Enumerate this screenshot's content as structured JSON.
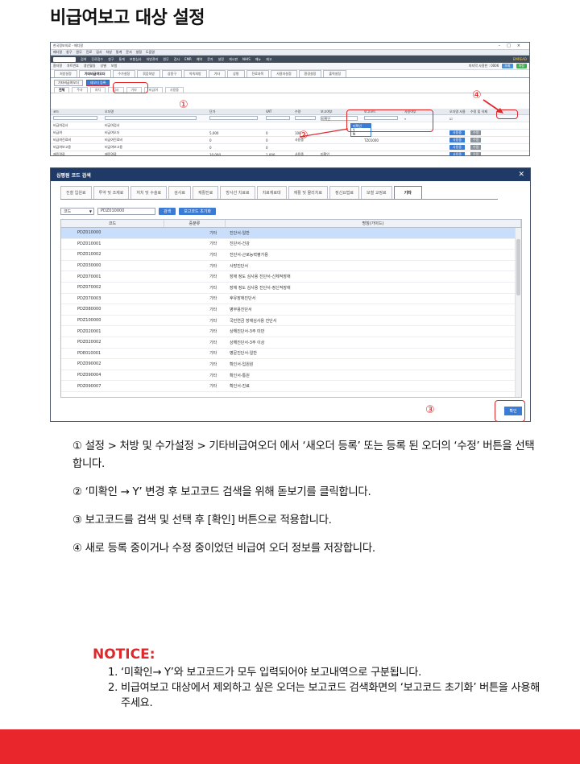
{
  "page_title": "비급여보고 대상 설정",
  "screen1": {
    "window_title": "한국정보의료 - 메디칼",
    "menu_items": [
      "메디칼",
      "청구",
      "원무",
      "진료",
      "검사",
      "처방",
      "통계",
      "문서",
      "설정",
      "도움말"
    ],
    "nav_items": [
      "검색",
      "진료접수",
      "청구",
      "통계",
      "보험심사",
      "처방관리",
      "원무",
      "검사",
      "EMR",
      "예약",
      "문자",
      "설정",
      "게시판",
      "NHIS",
      "메뉴",
      "재고"
    ],
    "nav_brand": "EMREAD",
    "patient_bar": [
      "환자명",
      "차트번호",
      "생년월일",
      "성별",
      "보험"
    ],
    "patient_right": "마지막 사용한 : 0006",
    "patient_btn_a": "조회",
    "patient_btn_b": "저장",
    "tabs": [
      "처방설정",
      "기타비급여오더",
      "수가설정",
      "묶음처방",
      "상용구",
      "약속처방",
      "기타",
      "상병",
      "진료과목",
      "사용자설정",
      "환경설정",
      "출력설정"
    ],
    "active_tab": "기타비급여오더",
    "buttons": [
      "기타비급여오더",
      "새오더 등록"
    ],
    "subtabs": [
      "전체",
      "주사",
      "처치",
      "검사",
      "기타",
      "비급여",
      "사용중"
    ],
    "table_headers": [
      "코드",
      "오더명",
      "단가",
      "VAT",
      "수량",
      "보고여부",
      "보고코드",
      "사용여부",
      "오더명 사용",
      "수정 및 삭제"
    ],
    "rows": [
      [
        "비급여검사",
        "비급여검사",
        "",
        "",
        "",
        "",
        "",
        "",
        "",
        ""
      ],
      [
        "비급여",
        "비급여오더",
        "5,000",
        "0",
        "100",
        "",
        "",
        "",
        "사용중",
        "수정"
      ],
      [
        "비급여진료비",
        "비급여진료비",
        "0",
        "0",
        "사용중",
        "",
        "TZ01000",
        "",
        "사용중",
        "수정"
      ],
      [
        "비급여보고용",
        "비급여보고용",
        "0",
        "0",
        "",
        "",
        "",
        "",
        "사용중",
        "수정"
      ],
      [
        "제증명료",
        "제증명료",
        "10,000",
        "1,000",
        "사용중",
        "미확인",
        "",
        "",
        "사용중",
        "수정"
      ]
    ],
    "dropdown_options": [
      "미확인",
      "Y",
      "N"
    ],
    "filter_value": "미확인",
    "markers": [
      "①",
      "②",
      "④"
    ]
  },
  "screen2": {
    "dialog_title": "심평원 코드 검색",
    "tabs": [
      "진찰 입원료",
      "투약 및 조제료",
      "처치 및 수술료",
      "검사료",
      "재활진료",
      "방사선 치료료",
      "치료재료대",
      "재활 및 물리치료",
      "정신요법료",
      "보철 교정료",
      "기타"
    ],
    "active_tab": "기타",
    "search_select": "코드",
    "search_value": "PDZ010000",
    "search_button": "검색",
    "reset_button": "보고코드 초기화",
    "columns": [
      "코드",
      "중분류",
      "명칭(가이드)"
    ],
    "rows": [
      [
        "PDZ010000",
        "기타",
        "진단서-일반"
      ],
      [
        "PDZ010001",
        "기타",
        "진단서-건강"
      ],
      [
        "PDZ010002",
        "기타",
        "진단서-근로능력평가용"
      ],
      [
        "PDZ030000",
        "기타",
        "사망진단서"
      ],
      [
        "PDZ070001",
        "기타",
        "장애 정도 심사용 진단서-신체적장애"
      ],
      [
        "PDZ070002",
        "기타",
        "장애 정도 심사용 진단서-정신적장애"
      ],
      [
        "PDZ070003",
        "기타",
        "후유장애진단서"
      ],
      [
        "PDZ080000",
        "기타",
        "병무용진단서"
      ],
      [
        "PDZ100000",
        "기타",
        "국민연금 장애심사용 진단서"
      ],
      [
        "PDZ020001",
        "기타",
        "상해진단서-3주 미만"
      ],
      [
        "PDZ020002",
        "기타",
        "상해진단서-3주 이상"
      ],
      [
        "PDE010001",
        "기타",
        "병문진단서-일반"
      ],
      [
        "PDZ090002",
        "기타",
        "확인서-입원원"
      ],
      [
        "PDZ090004",
        "기타",
        "확인서-통원"
      ],
      [
        "PDZ090007",
        "기타",
        "확인서-진료"
      ]
    ],
    "ok_button": "확인",
    "marker": "③"
  },
  "steps": [
    "① 설정 > 처방 및 수가설정 > 기타비급여오더 에서 ‘새오더 등록’ 또는 등록 된 오더의 ‘수정’ 버튼을 선택합니다.",
    "② ‘미확인 → Y’ 변경 후  보고코드 검색을 위해 돋보기를 클릭합니다.",
    "③ 보고코드를 검색 및 선택 후 [확인] 버튼으로 적용합니다.",
    "④ 새로 등록 중이거나 수정 중이었던 비급여 오더 정보를 저장합니다."
  ],
  "notice": {
    "title": "NOTICE:",
    "items": [
      {
        "num": "1.",
        "text": "‘미확인→ Y’와 보고코드가 모두 입력되어야 보고내역으로 구분됩니다."
      },
      {
        "num": "2.",
        "text": "비급여보고 대상에서 제외하고 싶은 오더는 보고코드 검색화면의  ‘보고코드 초기화’ 버튼을 사용해주세요."
      }
    ]
  },
  "colors": {
    "accent_red": "#e0282b",
    "footer_red": "#e8262b",
    "button_blue": "#3a7bd5",
    "dialog_header": "#1f3a66"
  }
}
